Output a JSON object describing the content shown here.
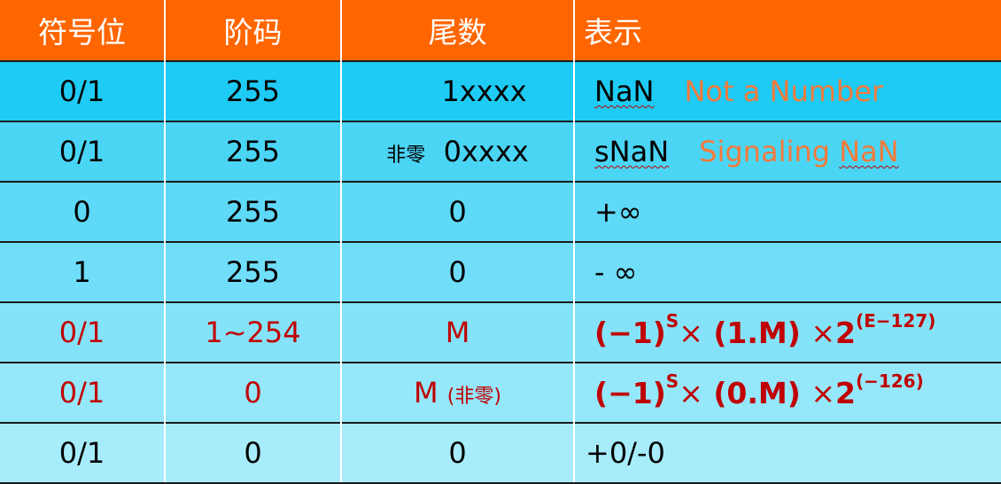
{
  "header": {
    "sign": "符号位",
    "exponent": "阶码",
    "mantissa": "尾数",
    "meaning": "表示"
  },
  "rows": [
    {
      "sign": "0/1",
      "exponent": "255",
      "mantissa": "1xxxx",
      "meaning": "NaN",
      "note": "Not a Number"
    },
    {
      "sign": "0/1",
      "exponent": "255",
      "mantissa_prefix": "非零",
      "mantissa": "0xxxx",
      "meaning": "sNaN",
      "note_word": "Signaling",
      "note_nan": "NaN"
    },
    {
      "sign": "0",
      "exponent": "255",
      "mantissa": "0",
      "meaning": "+∞"
    },
    {
      "sign": "1",
      "exponent": "255",
      "mantissa": "0",
      "meaning": "- ∞"
    },
    {
      "sign": "0/1",
      "exponent": "1~254",
      "mantissa": "M",
      "formula": {
        "base": "(−1)",
        "sup1": "S",
        "times": "×",
        "mid": " (1.M) ",
        "times2": "×",
        "two": "2",
        "sup2": "(E−127)"
      }
    },
    {
      "sign": "0/1",
      "exponent": "0",
      "mantissa": "M",
      "mantissa_suffix": "(非零)",
      "formula": {
        "base": "(−1)",
        "sup1": "S",
        "times": "×",
        "mid": " (0.M) ",
        "times2": "×",
        "two": "2",
        "sup2": "(−126)"
      }
    },
    {
      "sign": "0/1",
      "exponent": "0",
      "mantissa": "0",
      "meaning": "+0/-0"
    }
  ],
  "colors": {
    "header": "#ff6600",
    "note": "#f47a3a",
    "emphasis": "#c00000"
  }
}
